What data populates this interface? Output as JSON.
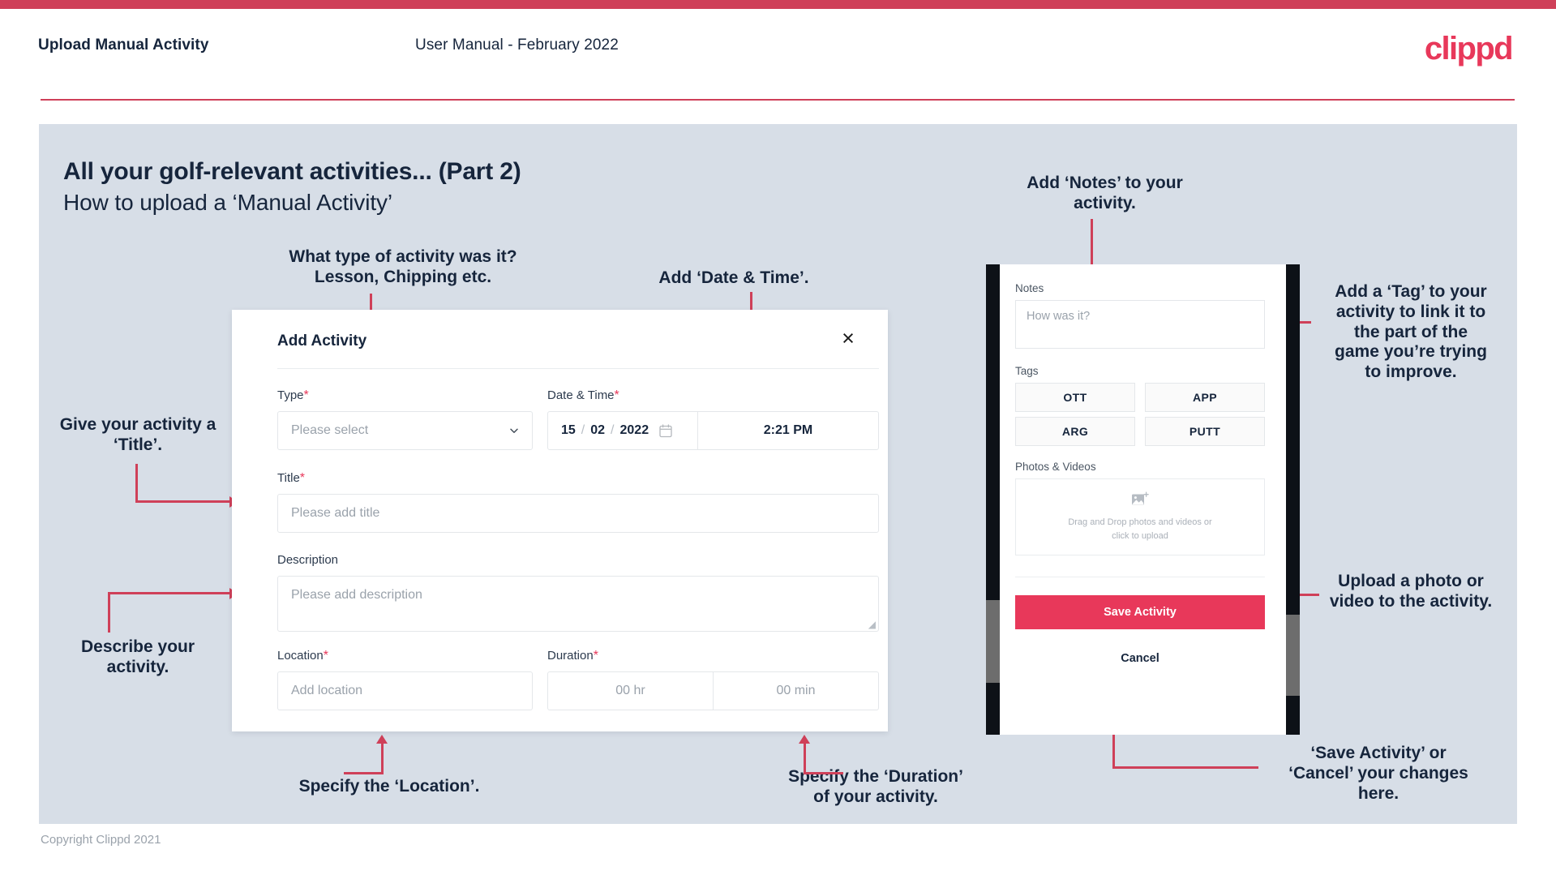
{
  "header": {
    "title": "Upload Manual Activity",
    "subtitle": "User Manual - February 2022",
    "logo": "clippd"
  },
  "slide": {
    "title": "All your golf-relevant activities... (Part 2)",
    "subtitle": "How to upload a ‘Manual Activity’"
  },
  "annotations": {
    "type": "What type of activity was it?\nLesson, Chipping etc.",
    "datetime": "Add ‘Date & Time’.",
    "title": "Give your activity a\n‘Title’.",
    "description": "Describe your\nactivity.",
    "location": "Specify the ‘Location’.",
    "duration": "Specify the ‘Duration’\nof your activity.",
    "notes": "Add ‘Notes’ to your\nactivity.",
    "tags": "Add a ‘Tag’ to your\nactivity to link it to\nthe part of the\ngame you’re trying\nto improve.",
    "upload": "Upload a photo or\nvideo to the activity.",
    "save": "‘Save Activity’ or\n‘Cancel’ your changes\nhere."
  },
  "dialog": {
    "title": "Add Activity",
    "close_icon": "×",
    "fields": {
      "type": {
        "label": "Type",
        "required": "*",
        "placeholder": "Please select"
      },
      "datetime": {
        "label": "Date & Time",
        "required": "*",
        "day": "15",
        "month": "02",
        "year": "2022",
        "sep": "/",
        "time": "2:21 PM"
      },
      "title": {
        "label": "Title",
        "required": "*",
        "placeholder": "Please add title"
      },
      "description": {
        "label": "Description",
        "required": "",
        "placeholder": "Please add description"
      },
      "location": {
        "label": "Location",
        "required": "*",
        "placeholder": "Add location"
      },
      "duration": {
        "label": "Duration",
        "required": "*",
        "hours": "00 hr",
        "minutes": "00 min"
      }
    }
  },
  "phone": {
    "notes": {
      "label": "Notes",
      "placeholder": "How was it?"
    },
    "tags": {
      "label": "Tags",
      "items": [
        "OTT",
        "APP",
        "ARG",
        "PUTT"
      ]
    },
    "photos": {
      "label": "Photos & Videos",
      "dropzone_text": "Drag and Drop photos and videos or\nclick to upload"
    },
    "save_label": "Save Activity",
    "cancel_label": "Cancel"
  },
  "footer": {
    "copyright": "Copyright Clippd 2021"
  },
  "colors": {
    "accent": "#e8385a",
    "bar": "#cf4059",
    "slide_bg": "#d7dee7",
    "text": "#16253c"
  }
}
